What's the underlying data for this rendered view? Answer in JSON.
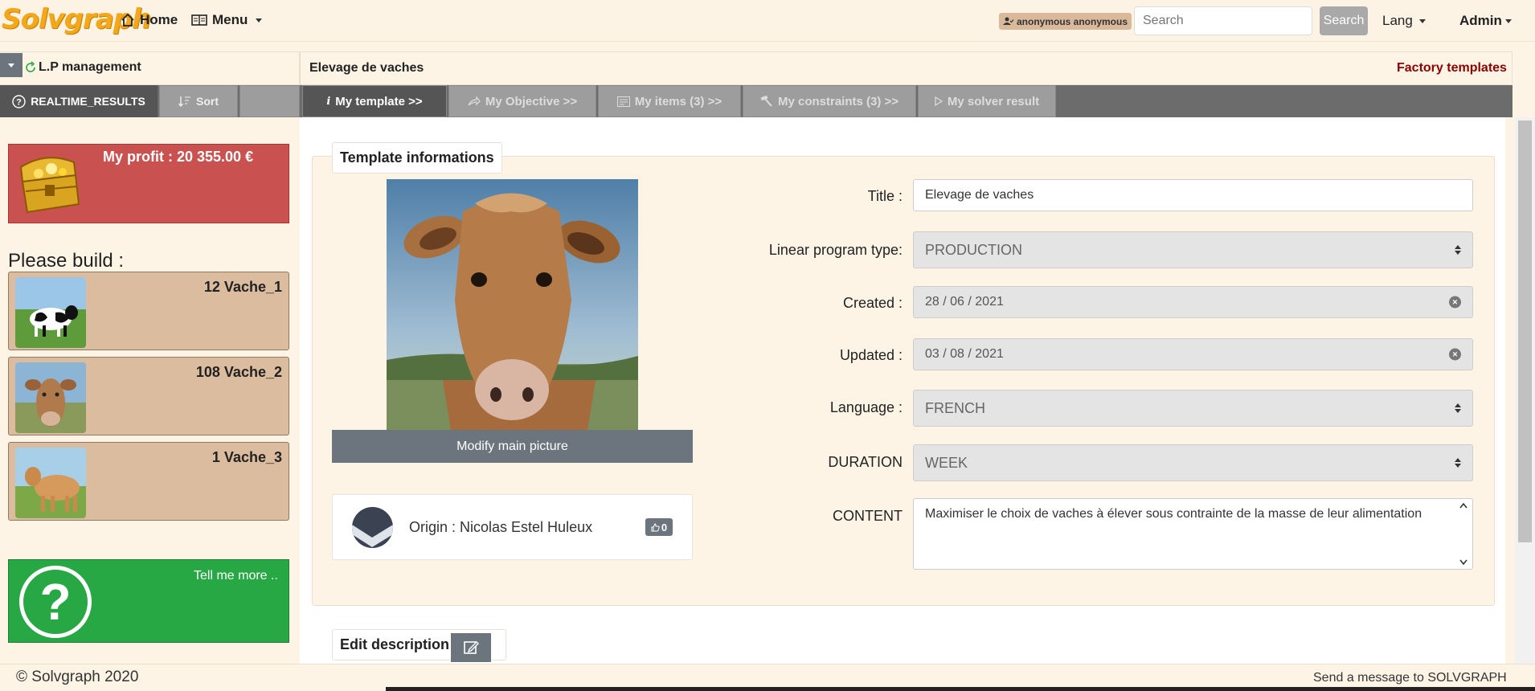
{
  "navbar": {
    "logo": "Solvgraph",
    "home": "Home",
    "menu": "Menu",
    "user": "anonymous anonymous",
    "search_placeholder": "Search",
    "search_button": "Search",
    "lang": "Lang",
    "admin": "Admin"
  },
  "left": {
    "title": "L.P management",
    "tabs": [
      "REALTIME_RESULTS",
      "Sort"
    ],
    "profit": "My profit : 20 355.00 €",
    "please_build": "Please build :",
    "builds": [
      {
        "label": "12 Vache_1"
      },
      {
        "label": "108 Vache_2"
      },
      {
        "label": "1 Vache_3"
      }
    ],
    "help": "Tell me more .."
  },
  "main": {
    "title": "Elevage de vaches",
    "factory_link": "Factory templates",
    "tabs": [
      "My template >>",
      "My Objective >>",
      "My items (3) >>",
      "My constraints (3) >>",
      "My solver result"
    ],
    "section_title": "Template informations",
    "modify_picture": "Modify main picture",
    "origin": "Origin : Nicolas Estel Huleux",
    "likes": "0",
    "fields": {
      "title_label": "Title :",
      "title_value": "Elevage de vaches",
      "type_label": "Linear program type:",
      "type_value": "PRODUCTION",
      "created_label": "Created :",
      "created_value": "28 / 06 / 2021",
      "updated_label": "Updated :",
      "updated_value": "03 / 08 / 2021",
      "language_label": "Language :",
      "language_value": "FRENCH",
      "duration_label": "DURATION",
      "duration_value": "WEEK",
      "content_label": "CONTENT",
      "content_value": "Maximiser le choix de vaches à élever sous contrainte de la masse de leur alimentation"
    },
    "edit_description": "Edit description"
  },
  "footer": {
    "copyright": "© Solvgraph 2020",
    "message": "Send a message to SOLVGRAPH"
  },
  "colors": {
    "profit_bg": "#c9514f",
    "help_bg": "#28a745",
    "build_bg": "#dcbc9e",
    "accent_dark": "#8b0000"
  }
}
